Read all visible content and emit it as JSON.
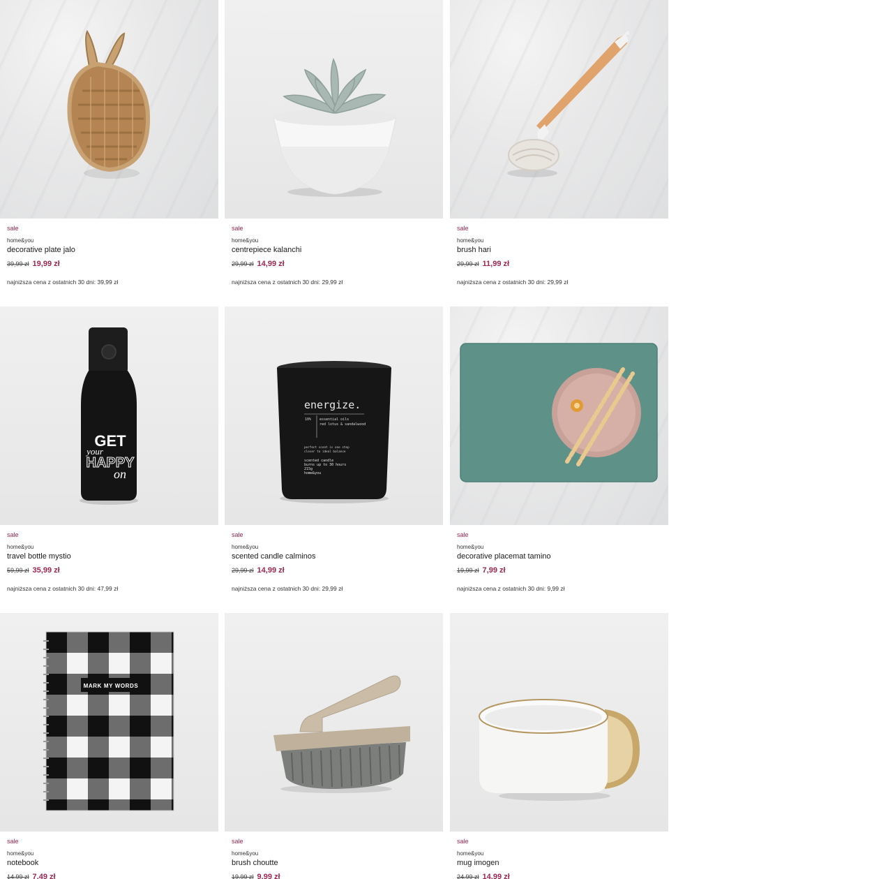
{
  "products": [
    {
      "badge": "sale",
      "brand": "home&you",
      "name": "decorative plate jalo",
      "old_price": "39,99 zł",
      "new_price": "19,99 zł",
      "lowest": "najniższa cena z ostatnich 30 dni: 39,99 zł"
    },
    {
      "badge": "sale",
      "brand": "home&you",
      "name": "centrepiece kalanchi",
      "old_price": "29,99 zł",
      "new_price": "14,99 zł",
      "lowest": "najniższa cena z ostatnich 30 dni: 29,99 zł"
    },
    {
      "badge": "sale",
      "brand": "home&you",
      "name": "brush hari",
      "old_price": "29,99 zł",
      "new_price": "11,99 zł",
      "lowest": "najniższa cena z ostatnich 30 dni: 29,99 zł"
    },
    {
      "badge": "sale",
      "brand": "home&you",
      "name": "travel bottle mystio",
      "old_price": "59,99 zł",
      "new_price": "35,99 zł",
      "lowest": "najniższa cena z ostatnich 30 dni: 47,99 zł"
    },
    {
      "badge": "sale",
      "brand": "home&you",
      "name": "scented candle calminos",
      "old_price": "29,99 zł",
      "new_price": "14,99 zł",
      "lowest": "najniższa cena z ostatnich 30 dni: 29,99 zł"
    },
    {
      "badge": "sale",
      "brand": "home&you",
      "name": "decorative placemat tamino",
      "old_price": "19,99 zł",
      "new_price": "7,99 zł",
      "lowest": "najniższa cena z ostatnich 30 dni: 9,99 zł"
    },
    {
      "badge": "sale",
      "brand": "home&you",
      "name": "notebook",
      "old_price": "14,99 zł",
      "new_price": "7,49 zł",
      "lowest": ""
    },
    {
      "badge": "sale",
      "brand": "home&you",
      "name": "brush choutte",
      "old_price": "19,99 zł",
      "new_price": "9,99 zł",
      "lowest": ""
    },
    {
      "badge": "sale",
      "brand": "home&you",
      "name": "mug imogen",
      "old_price": "24,99 zł",
      "new_price": "14,99 zł",
      "lowest": ""
    }
  ],
  "product_text": {
    "bottle_get": "GET",
    "bottle_your": "your",
    "bottle_happy": "HAPPY",
    "bottle_on": "on",
    "candle_title": "energize.",
    "candle_pct": "10%",
    "candle_oils": "essential oils",
    "candle_scent": "red lotus & sandalwood",
    "candle_line1": "perfect scent is one step",
    "candle_line2": "closer to ideal balance",
    "candle_line3": "scented candle",
    "candle_line4": "burns up to 30 hours",
    "candle_line5": "215g",
    "candle_line6": "home&you",
    "notebook_label": "MARK MY WORDS"
  },
  "colors": {
    "sale_accent": "#a0264f"
  }
}
